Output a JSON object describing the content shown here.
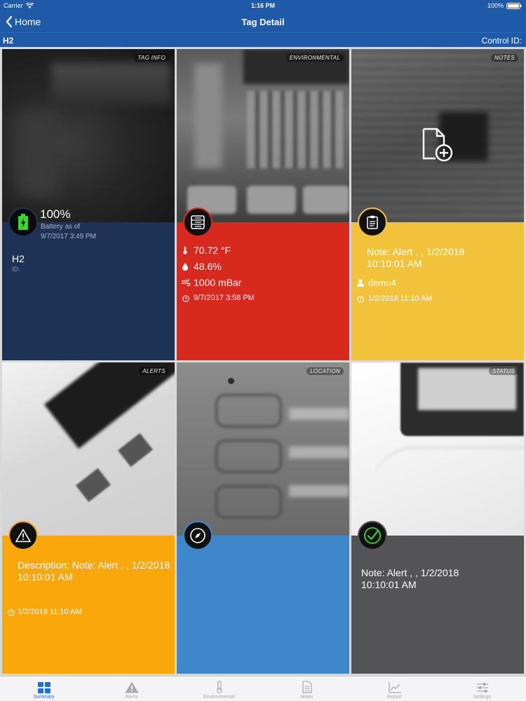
{
  "status_bar": {
    "carrier": "Carrier",
    "time": "1:16 PM",
    "battery": "100%"
  },
  "nav": {
    "back_label": "Home",
    "title": "Tag Detail"
  },
  "subheader": {
    "tag_name": "H2",
    "control_id_label": "Control ID:"
  },
  "tiles": {
    "tag_info": {
      "tag": "TAG INFO",
      "battery_percent": "100%",
      "battery_as_of": "Battery as of",
      "battery_date": "9/7/2017 3:49 PM",
      "name": "H2",
      "id_label": "ID:",
      "color": "#1e3256"
    },
    "environmental": {
      "tag": "ENVIRONMENTAL",
      "temperature": "70.72 °F",
      "humidity": "48.6%",
      "pressure": "1000 mBar",
      "timestamp": "9/7/2017 3:58 PM",
      "color": "#d8291f"
    },
    "notes": {
      "tag": "NOTES",
      "note_text": "Note: Alert , , 1/2/2018 10:10:01 AM",
      "user": "demo4",
      "timestamp": "1/2/2018 11:10 AM",
      "color": "#f2c23a"
    },
    "alerts": {
      "tag": "ALERTS",
      "description": "Description: Note: Alert , , 1/2/2018 10:10:01 AM",
      "timestamp": "1/2/2018 11:10 AM",
      "color": "#f9a70b"
    },
    "location": {
      "tag": "LOCATION",
      "color": "#3d87ca"
    },
    "status": {
      "tag": "STATUS",
      "note_text": "Note: Alert , , 1/2/2018 10:10:01 AM",
      "color": "#545456"
    }
  },
  "tab_bar": [
    {
      "label": "Summary",
      "icon": "grid-icon",
      "active": true
    },
    {
      "label": "Alerts",
      "icon": "warning-icon",
      "active": false
    },
    {
      "label": "Environmental",
      "icon": "thermometer-icon",
      "active": false
    },
    {
      "label": "Notes",
      "icon": "document-icon",
      "active": false
    },
    {
      "label": "Report",
      "icon": "chart-icon",
      "active": false
    },
    {
      "label": "Settings",
      "icon": "sliders-icon",
      "active": false
    }
  ]
}
